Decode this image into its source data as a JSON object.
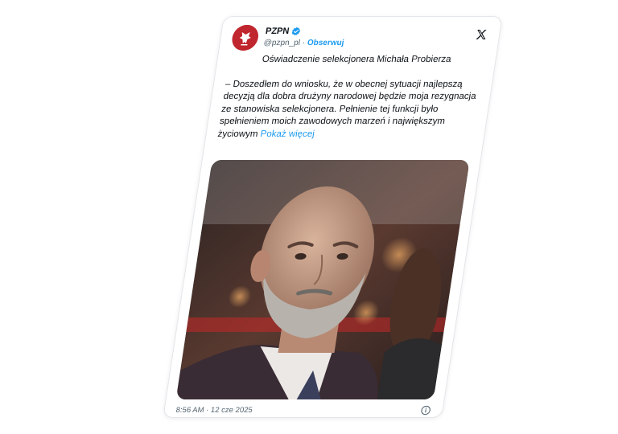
{
  "account": {
    "display_name": "PZPN",
    "handle": "@pzpn_pl",
    "separator": "·",
    "follow_label": "Obserwuj",
    "avatar_icon": "pzpn-eagle-logo",
    "verified_icon": "verified-badge-icon",
    "platform_icon": "x-logo-icon"
  },
  "tweet": {
    "title": "Oświadczenie selekcjonera Michała Probierza",
    "body": "– Doszedłem do wniosku, że w obecnej sytuacji najlepszą decyzją dla dobra drużyny narodowej będzie moja rezygnacja ze stanowiska selekcjonera. Pełnienie tej funkcji było spełnieniem moich zawodowych marzeń i największym życiowym",
    "show_more": "Pokaż więcej",
    "image_alt": "photo of a bald man with a grey beard in a dark suit"
  },
  "footer": {
    "timestamp": "8:56 AM · 12 cze 2025",
    "info_icon": "info-icon"
  },
  "colors": {
    "accent": "#1d9bf0",
    "avatar_bg": "#c0262d",
    "text": "#0f1419",
    "muted": "#536471"
  }
}
